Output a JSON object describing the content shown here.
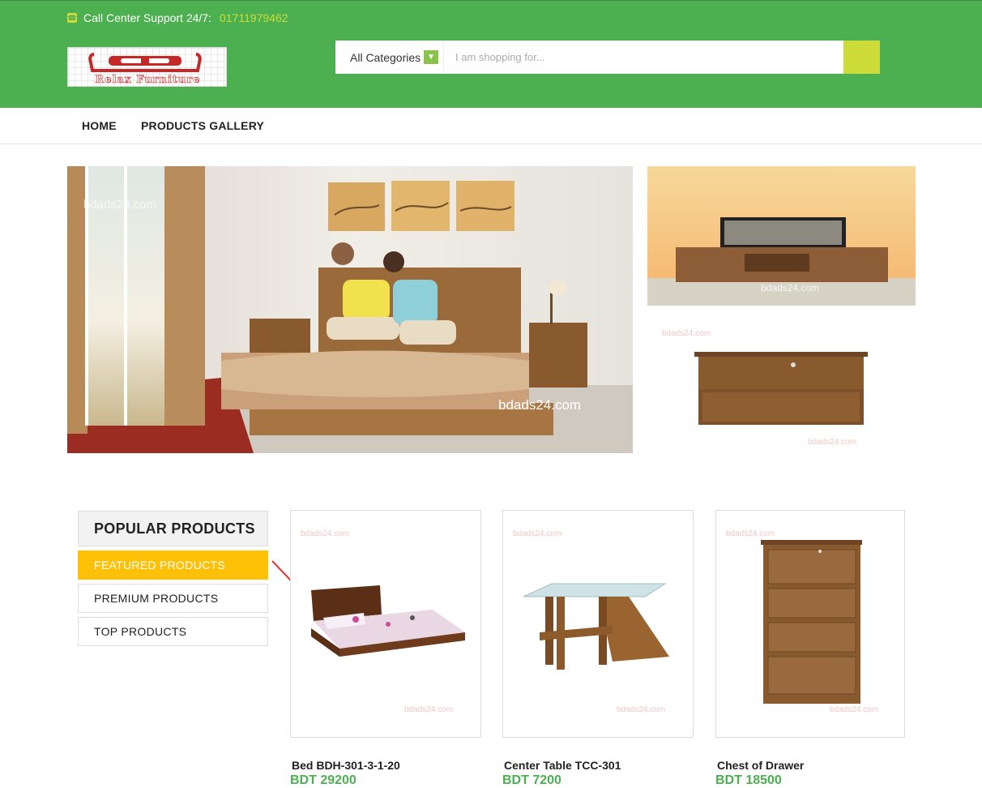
{
  "header": {
    "support_label": "Call Center Support 24/7:",
    "support_phone": "01711979462",
    "logo_text": "Relax Furniture"
  },
  "search": {
    "category": "All Categories",
    "placeholder": "I am shopping for..."
  },
  "nav": {
    "items": [
      {
        "label": "HOME"
      },
      {
        "label": "PRODUCTS GALLERY"
      }
    ]
  },
  "banners": {
    "watermark": "bdads24.com"
  },
  "products_tabs": {
    "heading": "POPULAR PRODUCTS",
    "tabs": [
      {
        "label": "FEATURED PRODUCTS",
        "active": true
      },
      {
        "label": "PREMIUM PRODUCTS",
        "active": false
      },
      {
        "label": "TOP PRODUCTS",
        "active": false
      }
    ]
  },
  "products": [
    {
      "name": "Bed BDH-301-3-1-20",
      "price": "BDT 29200"
    },
    {
      "name": "Center Table TCC-301",
      "price": "BDT 7200"
    },
    {
      "name": "Chest of Drawer",
      "price": "BDT 18500"
    }
  ],
  "colors": {
    "header_green": "#4caf50",
    "accent_lime": "#cddc39",
    "active_tab": "#ffc107",
    "price_green": "#4caf50"
  }
}
